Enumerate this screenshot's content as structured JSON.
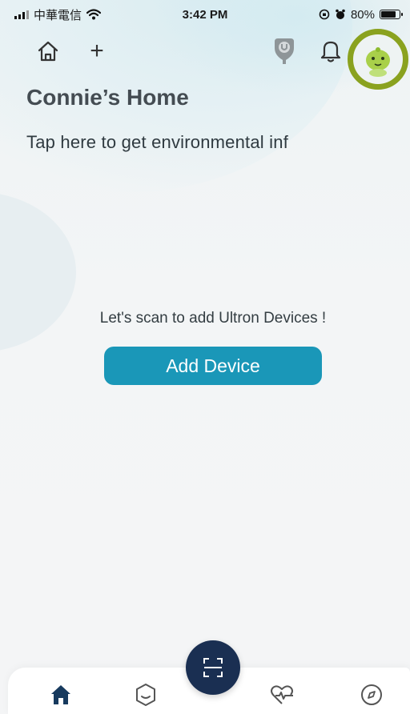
{
  "status_bar": {
    "carrier": "中華電信",
    "time": "3:42 PM",
    "battery_percent": "80%",
    "battery_level": 0.8
  },
  "top_bar": {
    "plus_label": "+",
    "icons": [
      "home-icon",
      "add-icon",
      "badge-icon",
      "bell-icon",
      "avatar"
    ]
  },
  "header": {
    "title": "Connie’s Home",
    "env_prompt": "Tap here to get environmental inf"
  },
  "empty_state": {
    "message": "Let's scan to add Ultron Devices !",
    "button_label": "Add Device"
  },
  "bottom_nav": {
    "items": [
      "home-icon",
      "scene-icon",
      "scan-icon",
      "health-icon",
      "explore-icon"
    ],
    "active": "home-icon"
  },
  "colors": {
    "accent": "#1a97b8",
    "nav_active": "#173a5e",
    "fab": "#1a2f52",
    "avatar_ring": "#8aa21f"
  }
}
